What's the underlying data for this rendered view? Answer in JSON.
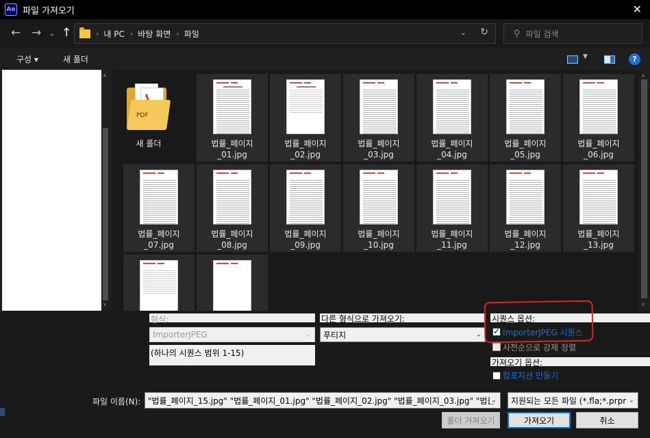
{
  "window": {
    "app_badge": "Ae",
    "title": "파일 가져오기",
    "close_label": "✕"
  },
  "nav": {
    "back_icon": "arrow-left-icon",
    "forward_icon": "arrow-right-icon",
    "up_icon": "arrow-up-icon",
    "breadcrumb": [
      "내 PC",
      "바탕 화면",
      "파일"
    ],
    "search_placeholder": "파일 검색"
  },
  "toolbar": {
    "organize_label": "구성 ▾",
    "new_folder_label": "새 폴더"
  },
  "files": [
    {
      "type": "folder",
      "name": "새 폴더",
      "icon": "pdf-folder-icon"
    },
    {
      "type": "image",
      "name": [
        "법률_페이지",
        "_01.jpg"
      ]
    },
    {
      "type": "image",
      "name": [
        "법률_페이지",
        "_02.jpg"
      ]
    },
    {
      "type": "image",
      "name": [
        "법률_페이지",
        "_03.jpg"
      ]
    },
    {
      "type": "image",
      "name": [
        "법률_페이지",
        "_04.jpg"
      ]
    },
    {
      "type": "image",
      "name": [
        "법률_페이지",
        "_05.jpg"
      ]
    },
    {
      "type": "image",
      "name": [
        "법률_페이지",
        "_06.jpg"
      ]
    },
    {
      "type": "image",
      "name": [
        "법률_페이지",
        "_07.jpg"
      ]
    },
    {
      "type": "image",
      "name": [
        "법률_페이지",
        "_08.jpg"
      ]
    },
    {
      "type": "image",
      "name": [
        "법률_페이지",
        "_09.jpg"
      ]
    },
    {
      "type": "image",
      "name": [
        "법률_페이지",
        "_10.jpg"
      ]
    },
    {
      "type": "image",
      "name": [
        "법률_페이지",
        "_11.jpg"
      ]
    },
    {
      "type": "image",
      "name": [
        "법률_페이지",
        "_12.jpg"
      ]
    },
    {
      "type": "image",
      "name": [
        "법률_페이지",
        "_13.jpg"
      ]
    },
    {
      "type": "image",
      "name": [
        "",
        ""
      ]
    },
    {
      "type": "image",
      "name": [
        "",
        ""
      ]
    }
  ],
  "options": {
    "format_label": "형식:",
    "format_value": "ImporterJPEG",
    "sequence_range": "(하나의 시퀀스 범위 1-15)",
    "import_as_label": "다른 형식으로 가져오기:",
    "import_as_value": "푸티지",
    "sequence_options_label": "시퀀스 옵션:",
    "sequence_checkbox_label": "ImporterJPEG 시퀀스",
    "sequence_checked": true,
    "alpha_order_label": "사전순으로 강제 정렬",
    "import_options_label": "가져오기 옵션:",
    "create_comp_label": "컴포지션 만들기",
    "filename_label": "파일 이름(N):",
    "filename_value": "\"법률_페이지_15.jpg\" \"법률_페이지_01.jpg\" \"법률_페이지_02.jpg\" \"법률_페이지_03.jpg\" \"법률",
    "filetype_value": "지원되는 모든 파일 (*.fla;*.prpr",
    "import_folder_label": "폴더 가져오기",
    "import_label": "가져오기",
    "cancel_label": "취소"
  },
  "colors": {
    "accent": "#0078d7",
    "highlight_box": "#e3202b",
    "link_blue": "#1e6fd9"
  }
}
